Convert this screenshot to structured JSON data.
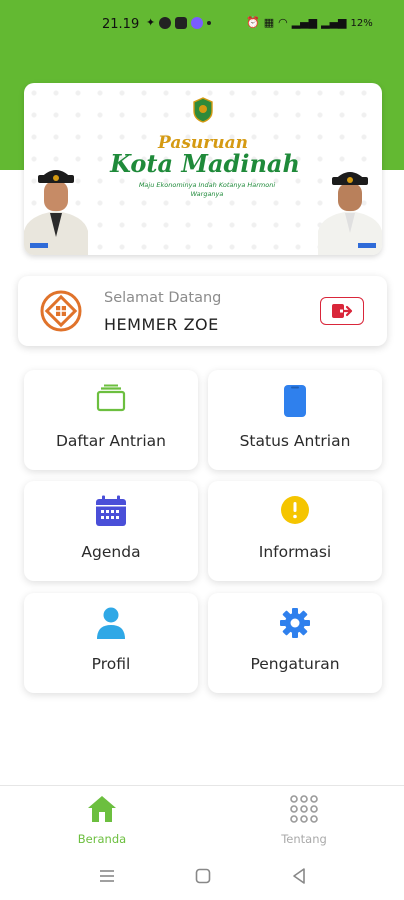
{
  "statusbar": {
    "time": "21.19",
    "battery": "12%"
  },
  "banner": {
    "title_line1": "Pasuruan",
    "title_line2": "Kota Madinah",
    "tagline": "Maju Ekonominya Indah Kotanya Harmoni Warganya"
  },
  "welcome": {
    "label": "Selamat Datang",
    "name": "HEMMER ZOE"
  },
  "menu": [
    {
      "label": "Daftar Antrian",
      "icon": "card-stack-icon",
      "color": "#6cbf3f"
    },
    {
      "label": "Status Antrian",
      "icon": "tablet-icon",
      "color": "#2f80ed"
    },
    {
      "label": "Agenda",
      "icon": "calendar-icon",
      "color": "#4a4fd8"
    },
    {
      "label": "Informasi",
      "icon": "info-icon",
      "color": "#f5c500"
    },
    {
      "label": "Profil",
      "icon": "user-icon",
      "color": "#2fa8e6"
    },
    {
      "label": "Pengaturan",
      "icon": "gear-icon",
      "color": "#2f80ed"
    }
  ],
  "bottom_nav": {
    "home_label": "Beranda",
    "about_label": "Tentang"
  },
  "colors": {
    "brand_green": "#63b932",
    "logout_red": "#d9263a"
  }
}
